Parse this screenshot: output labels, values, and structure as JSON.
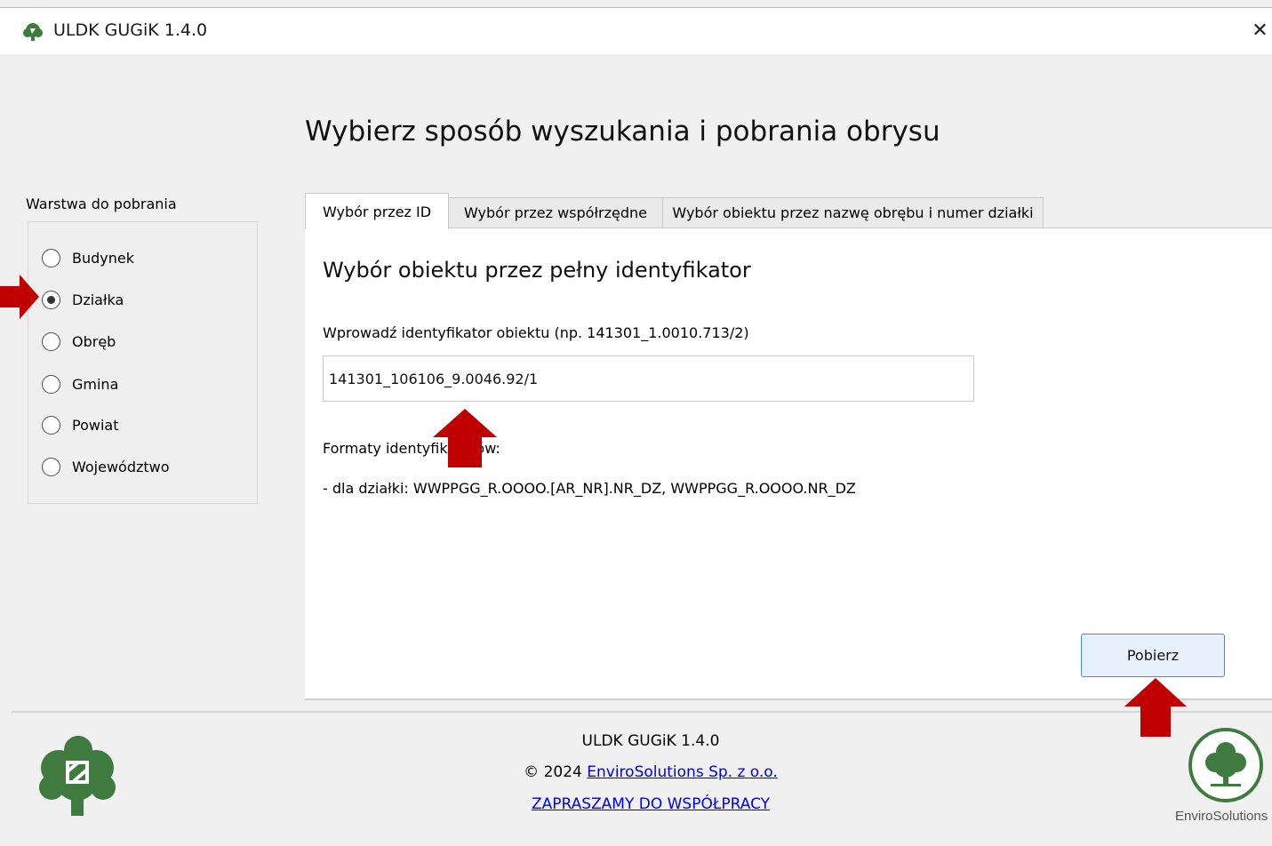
{
  "window": {
    "title": "ULDK GUGiK 1.4.0",
    "close_glyph": "✕"
  },
  "heading": "Wybierz sposób wyszukania i pobrania obrysu",
  "sidebar": {
    "label": "Warstwa do pobrania",
    "options": [
      {
        "label": "Budynek",
        "checked": false
      },
      {
        "label": "Działka",
        "checked": true
      },
      {
        "label": "Obręb",
        "checked": false
      },
      {
        "label": "Gmina",
        "checked": false
      },
      {
        "label": "Powiat",
        "checked": false
      },
      {
        "label": "Województwo",
        "checked": false
      }
    ]
  },
  "tabs": [
    {
      "label": "Wybór przez ID",
      "active": true
    },
    {
      "label": "Wybór przez współrzędne",
      "active": false
    },
    {
      "label": "Wybór obiektu przez nazwę obrębu i numer działki",
      "active": false
    }
  ],
  "panel": {
    "title": "Wybór obiektu przez pełny identyfikator",
    "input_label": "Wprowadź identyfikator obiektu (np. 141301_1.0010.713/2)",
    "input_value": "141301_106106_9.0046.92/1",
    "formats_label": "Formaty identyfikatorów:",
    "format_line": "- dla działki: WWPPGG_R.OOOO.[AR_NR].NR_DZ, WWPPGG_R.OOOO.NR_DZ",
    "button_label": "Pobierz"
  },
  "footer": {
    "version": "ULDK GUGiK 1.4.0",
    "copyright_prefix": "© 2024 ",
    "company_link": "EnviroSolutions Sp. z o.o.",
    "cooperation_link": "ZAPRASZAMY DO WSPÓŁPRACY",
    "logo_text": "EnviroSolutions"
  },
  "colors": {
    "accent_blue": "#3d8ede",
    "arrow_red": "#c00000",
    "logo_green": "#3f7a3f",
    "link_blue": "#0000ee"
  },
  "icons": [
    "app-tree-icon",
    "close-icon",
    "tree-logo-icon",
    "envirosolutions-logo-icon",
    "red-arrow-icon"
  ]
}
